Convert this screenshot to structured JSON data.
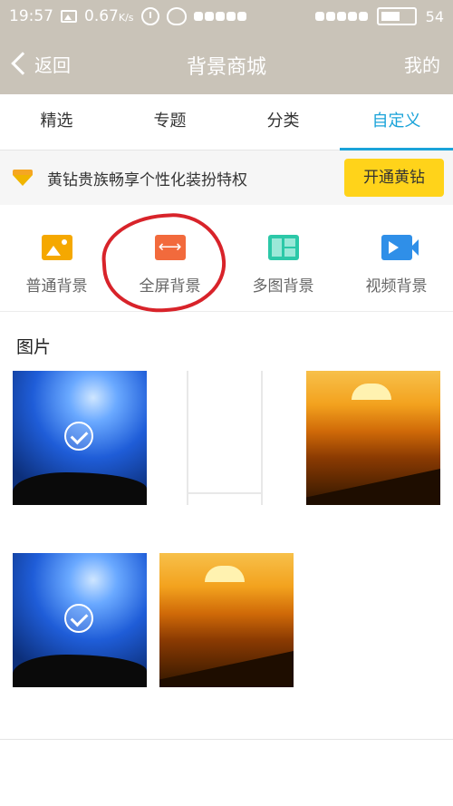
{
  "status_bar": {
    "time": "19:57",
    "speed": "0.67",
    "speed_unit": "K/s",
    "battery": "54"
  },
  "nav": {
    "back_label": "返回",
    "title": "背景商城",
    "mine_label": "我的"
  },
  "tabs": [
    {
      "label": "精选"
    },
    {
      "label": "专题"
    },
    {
      "label": "分类"
    },
    {
      "label": "自定义"
    }
  ],
  "active_tab": "自定义",
  "promo": {
    "icon": "diamond-icon",
    "text": "黄钻贵族畅享个性化装扮特权",
    "button": "开通黄钻"
  },
  "categories": [
    {
      "label": "普通背景",
      "icon": "image-icon",
      "color": "#f5a800"
    },
    {
      "label": "全屏背景",
      "icon": "fullscreen-arrows-icon",
      "color": "#f26a3c"
    },
    {
      "label": "多图背景",
      "icon": "grid-icon",
      "color": "#2cc8a8"
    },
    {
      "label": "视频背景",
      "icon": "video-camera-icon",
      "color": "#2f8fe8"
    }
  ],
  "section": {
    "title": "图片"
  },
  "images": [
    {
      "kind": "night-sky-couple",
      "selected": true
    },
    {
      "kind": "blank-frame",
      "selected": false
    },
    {
      "kind": "sunset-sea",
      "selected": false
    },
    {
      "kind": "night-sky-couple",
      "selected": true
    },
    {
      "kind": "sunset-sea",
      "selected": false
    }
  ],
  "colors": {
    "header_bg": "#c9c3b8",
    "accent": "#1aa3d9",
    "promo_button": "#ffd31a",
    "annotation": "#d8232a"
  }
}
